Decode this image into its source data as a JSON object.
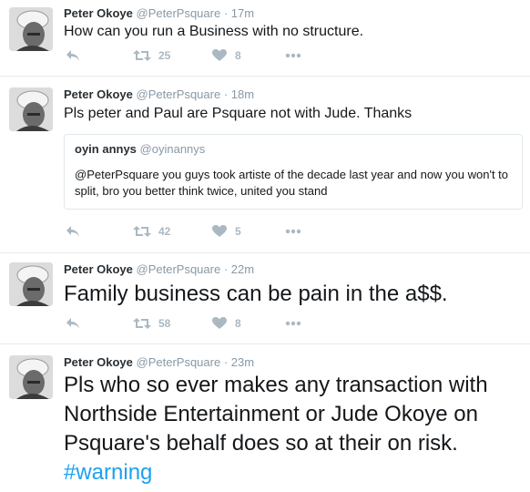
{
  "tweets": [
    {
      "name": "Peter Okoye",
      "handle": "@PeterPsquare",
      "dot": "·",
      "time": "17m",
      "text": "How can you run a Business with no structure.",
      "retweets": "25",
      "likes": "8"
    },
    {
      "name": "Peter Okoye",
      "handle": "@PeterPsquare",
      "dot": "·",
      "time": "18m",
      "text": "Pls peter and Paul are Psquare not with Jude. Thanks",
      "quote": {
        "name": "oyin annys",
        "handle": "@oyinannys",
        "text": "@PeterPsquare  you guys took artiste of the decade last year and now you won't to split, bro you better think twice, united you stand"
      },
      "retweets": "42",
      "likes": "5"
    },
    {
      "name": "Peter Okoye",
      "handle": "@PeterPsquare",
      "dot": "·",
      "time": "22m",
      "text": "Family business can be pain in the a$$.",
      "retweets": "58",
      "likes": "8"
    },
    {
      "name": "Peter Okoye",
      "handle": "@PeterPsquare",
      "dot": "·",
      "time": "23m",
      "text": "Pls who so ever makes any transaction with Northside Entertainment or Jude Okoye on Psquare's behalf does so at their on risk.",
      "hashtag": "#warning"
    }
  ],
  "colors": {
    "link": "#1da1f2",
    "muted": "#aab8c2",
    "border": "#e6ecf0"
  },
  "icons": [
    "reply-icon",
    "retweet-icon",
    "heart-icon",
    "more-icon"
  ]
}
